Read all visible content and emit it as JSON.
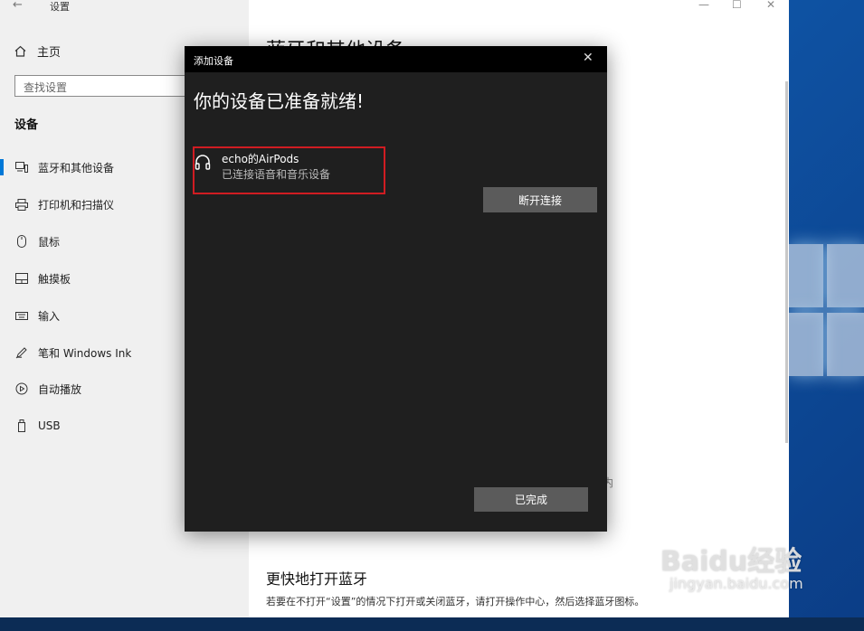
{
  "window": {
    "app_title": "设置",
    "back_icon": "←",
    "minimize_icon": "—",
    "maximize_icon": "☐",
    "close_icon": "✕"
  },
  "sidebar": {
    "home_label": "主页",
    "search_placeholder": "查找设置",
    "section_title": "设备",
    "items": [
      {
        "label": "蓝牙和其他设备",
        "icon": "bluetooth-devices-icon",
        "active": true
      },
      {
        "label": "打印机和扫描仪",
        "icon": "printer-icon",
        "active": false
      },
      {
        "label": "鼠标",
        "icon": "mouse-icon",
        "active": false
      },
      {
        "label": "触摸板",
        "icon": "touchpad-icon",
        "active": false
      },
      {
        "label": "输入",
        "icon": "keyboard-icon",
        "active": false
      },
      {
        "label": "笔和 Windows Ink",
        "icon": "pen-icon",
        "active": false
      },
      {
        "label": "自动播放",
        "icon": "autoplay-icon",
        "active": false
      },
      {
        "label": "USB",
        "icon": "usb-icon",
        "active": false
      }
    ]
  },
  "main": {
    "title": "蓝牙和其他设备",
    "fragment": "内",
    "quick_heading": "更快地打开蓝牙",
    "quick_text": "若要在不打开“设置”的情况下打开或关闭蓝牙，请打开操作中心，然后选择蓝牙图标。"
  },
  "dialog": {
    "title": "添加设备",
    "close_icon": "✕",
    "heading": "你的设备已准备就绪!",
    "device": {
      "name": "echo的AirPods",
      "status": "已连接语音和音乐设备",
      "icon": "headphones-icon"
    },
    "disconnect_label": "断开连接",
    "done_label": "已完成"
  },
  "watermark": {
    "brand": "Baidu经验",
    "url": "jingyan.baidu.com"
  },
  "colors": {
    "accent": "#0078d7",
    "dialog_bg": "#1f1f1f",
    "highlight_box": "#d01c22",
    "button_bg": "#5b5b5b"
  }
}
